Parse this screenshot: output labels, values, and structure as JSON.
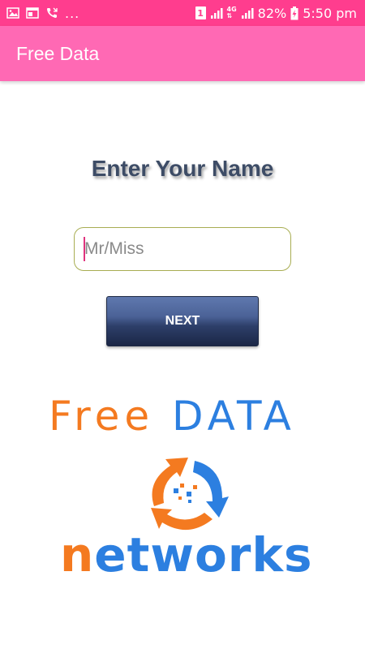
{
  "status_bar": {
    "left_icons": [
      "image-icon",
      "browser-icon",
      "missed-call-icon"
    ],
    "overflow": "...",
    "sim_slot": "1",
    "network_type_top": "4G",
    "network_type_bottom": "⇅",
    "battery": "82%",
    "time": "5:50 pm"
  },
  "app_bar": {
    "title": "Free Data",
    "color": "#ff69b4"
  },
  "main": {
    "heading": "Enter Your Name",
    "name_input": {
      "value": "",
      "placeholder": "Mr/Miss"
    },
    "next_label": "NEXT"
  },
  "logo": {
    "line1_part1": "Free",
    "line1_part2": "DATA",
    "line2_part1": "n",
    "line2_part2": "etworks",
    "colors": {
      "orange": "#f47a20",
      "blue": "#2c7fe0"
    }
  }
}
